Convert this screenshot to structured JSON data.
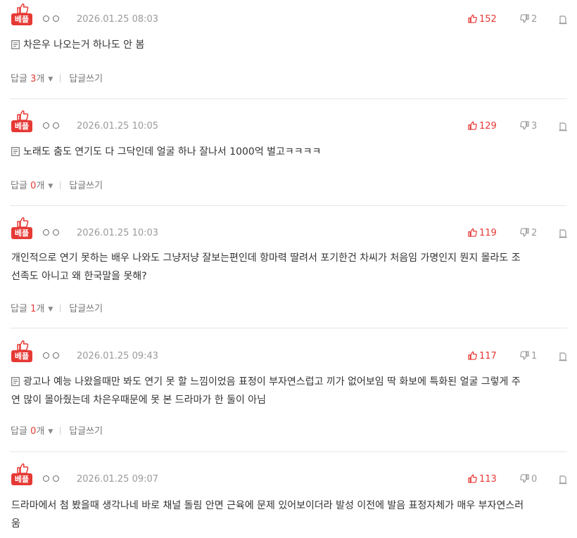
{
  "best_badge_label": "베플",
  "reply_label": "답글",
  "reply_count_suffix": "개",
  "write_reply_label": "답글쓰기",
  "accent_color": "#e53935",
  "icons": {
    "thumbs_up": "thumbs-up-icon",
    "thumbs_down": "thumbs-down-icon",
    "report": "report-icon",
    "document": "document-icon",
    "dropdown": "chevron-down-icon"
  },
  "comments": [
    {
      "date": "2026.01.25 08:03",
      "likes": "152",
      "dislikes": "2",
      "has_doc_icon": true,
      "text": "차은우 나오는거 하나도 안 봄",
      "reply_count": "3"
    },
    {
      "date": "2026.01.25 10:05",
      "likes": "129",
      "dislikes": "3",
      "has_doc_icon": true,
      "text": "노래도 춤도 연기도 다 그닥인데 얼굴 하나 잘나서 1000억 벌고ㅋㅋㅋㅋ",
      "reply_count": "0"
    },
    {
      "date": "2026.01.25 10:03",
      "likes": "119",
      "dislikes": "2",
      "has_doc_icon": false,
      "text": "개인적으로 연기 못하는 배우 나와도 그냥저냥 잘보는편인데 항마력 딸려서 포기한건 차씨가 처음임 가명인지 뭔지 몰라도 조선족도 아니고 왜 한국말을 못해?",
      "reply_count": "1"
    },
    {
      "date": "2026.01.25 09:43",
      "likes": "117",
      "dislikes": "1",
      "has_doc_icon": true,
      "text": "광고나 예능 나왔을때만 봐도 연기 못 할 느낌이었음 표정이 부자연스럽고 끼가 없어보임 딱 화보에 특화된 얼굴 그렇게 주연 많이 몰아줬는데 차은우때문에 못 본 드라마가 한 둘이 아님",
      "reply_count": "0"
    },
    {
      "date": "2026.01.25 09:07",
      "likes": "113",
      "dislikes": "0",
      "has_doc_icon": false,
      "text": "드라마에서 첨 봤을때 생각나네 바로 채널 돌림 안면 근육에 문제 있어보이더라 발성 이전에 발음 표정자체가 매우 부자연스러움",
      "reply_count": null
    }
  ]
}
